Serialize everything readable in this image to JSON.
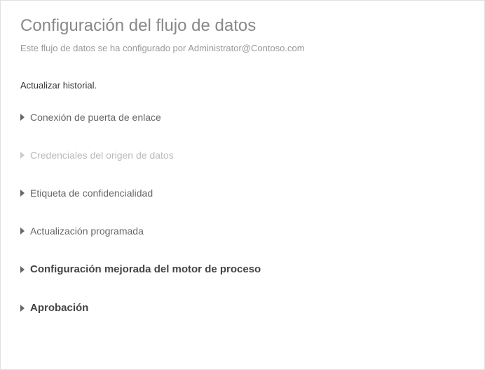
{
  "header": {
    "title": "Configuración del flujo de datos",
    "subtitle": "Este flujo de datos se ha configurado por Administrator@Contoso.com"
  },
  "history_link": "Actualizar historial.",
  "sections": {
    "gateway": "Conexión de puerta de enlace",
    "credentials": "Credenciales del origen de datos",
    "sensitivity": "Etiqueta de confidencialidad",
    "scheduled": "Actualización programada",
    "engine": "Configuración mejorada del motor de proceso",
    "approval": "Aprobación"
  }
}
